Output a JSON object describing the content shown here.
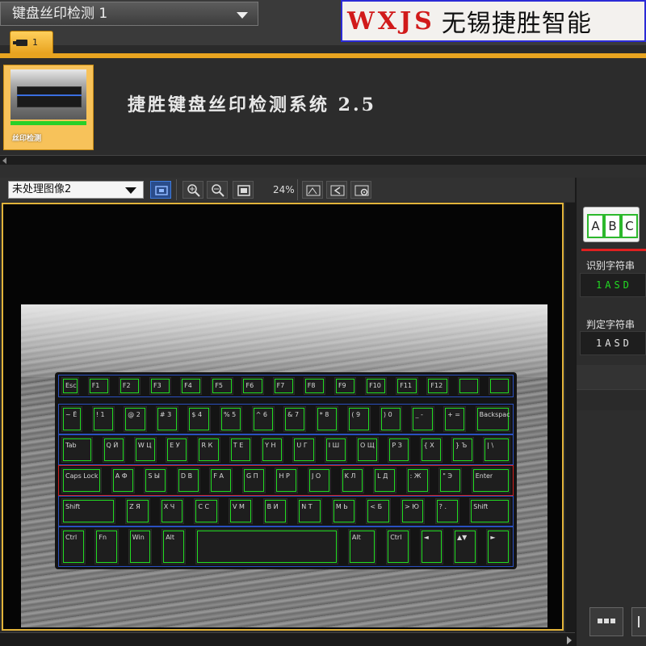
{
  "scene_selector": {
    "value": "键盘丝印检测 1"
  },
  "brand": {
    "code": "WXJS",
    "name": "无锡捷胜智能"
  },
  "tab": {
    "label": "1"
  },
  "thumbnail": {
    "label": "丝印检测"
  },
  "app_title": "捷胜键盘丝印检测系统 2.5",
  "image_toolbar": {
    "image_source": "未处理图像2",
    "zoom": "24%"
  },
  "right_panel": {
    "abc_letters": [
      "A",
      "B",
      "C"
    ],
    "recognized_label": "识别字符串",
    "recognized_value": "1ASD",
    "judge_label": "判定字符串",
    "judge_value": "1ASD"
  },
  "keyboard": {
    "rows": [
      {
        "name": "function-row",
        "keys": [
          {
            "t": "Esc",
            "w": 24
          },
          {
            "t": "F1",
            "w": 30
          },
          {
            "t": "F2",
            "w": 30
          },
          {
            "t": "F3",
            "w": 30
          },
          {
            "t": "F4",
            "w": 30
          },
          {
            "t": "F5",
            "w": 30
          },
          {
            "t": "F6",
            "w": 30
          },
          {
            "t": "F7",
            "w": 30
          },
          {
            "t": "F8",
            "w": 30
          },
          {
            "t": "F9",
            "w": 30
          },
          {
            "t": "F10",
            "w": 30
          },
          {
            "t": "F11",
            "w": 30
          },
          {
            "t": "F12",
            "w": 30
          },
          {
            "t": "",
            "w": 30
          },
          {
            "t": "",
            "w": 30
          }
        ]
      },
      {
        "name": "number-row",
        "keys": [
          {
            "t": "~ Ё",
            "w": 28
          },
          {
            "t": "! 1",
            "w": 30
          },
          {
            "t": "@ 2",
            "w": 30
          },
          {
            "t": "# 3",
            "w": 30
          },
          {
            "t": "$ 4",
            "w": 30
          },
          {
            "t": "% 5",
            "w": 30
          },
          {
            "t": "^ 6",
            "w": 30
          },
          {
            "t": "& 7",
            "w": 30
          },
          {
            "t": "* 8",
            "w": 30
          },
          {
            "t": "( 9",
            "w": 30
          },
          {
            "t": ") 0",
            "w": 30
          },
          {
            "t": "_ -",
            "w": 30
          },
          {
            "t": "+ =",
            "w": 30
          },
          {
            "t": "Backspace",
            "w": 46
          }
        ]
      },
      {
        "name": "qwerty-row",
        "keys": [
          {
            "t": "Tab",
            "w": 42
          },
          {
            "t": "Q Й",
            "w": 30
          },
          {
            "t": "W Ц",
            "w": 30
          },
          {
            "t": "E У",
            "w": 30
          },
          {
            "t": "R К",
            "w": 30
          },
          {
            "t": "T Е",
            "w": 30
          },
          {
            "t": "Y Н",
            "w": 30
          },
          {
            "t": "U Г",
            "w": 30
          },
          {
            "t": "I Ш",
            "w": 30
          },
          {
            "t": "O Щ",
            "w": 30
          },
          {
            "t": "P З",
            "w": 30
          },
          {
            "t": "{ Х",
            "w": 30
          },
          {
            "t": "} Ъ",
            "w": 30
          },
          {
            "t": "| \\",
            "w": 36
          }
        ]
      },
      {
        "name": "asdf-row",
        "keys": [
          {
            "t": "Caps Lock",
            "w": 52
          },
          {
            "t": "A Ф",
            "w": 30
          },
          {
            "t": "S Ы",
            "w": 30
          },
          {
            "t": "D В",
            "w": 30
          },
          {
            "t": "F А",
            "w": 30
          },
          {
            "t": "G П",
            "w": 30
          },
          {
            "t": "H Р",
            "w": 30
          },
          {
            "t": "J О",
            "w": 30
          },
          {
            "t": "K Л",
            "w": 30
          },
          {
            "t": "L Д",
            "w": 30
          },
          {
            "t": ": Ж",
            "w": 30
          },
          {
            "t": "\" Э",
            "w": 30
          },
          {
            "t": "Enter",
            "w": 50
          }
        ]
      },
      {
        "name": "zxcv-row",
        "keys": [
          {
            "t": "Shift",
            "w": 66
          },
          {
            "t": "Z Я",
            "w": 30
          },
          {
            "t": "X Ч",
            "w": 30
          },
          {
            "t": "C С",
            "w": 30
          },
          {
            "t": "V М",
            "w": 30
          },
          {
            "t": "B И",
            "w": 30
          },
          {
            "t": "N Т",
            "w": 30
          },
          {
            "t": "M Ь",
            "w": 30
          },
          {
            "t": "< Б",
            "w": 30
          },
          {
            "t": "> Ю",
            "w": 30
          },
          {
            "t": "? .",
            "w": 30
          },
          {
            "t": "Shift",
            "w": 50
          }
        ]
      },
      {
        "name": "space-row",
        "keys": [
          {
            "t": "Ctrl",
            "w": 30
          },
          {
            "t": "Fn",
            "w": 30
          },
          {
            "t": "Win",
            "w": 30
          },
          {
            "t": "Alt",
            "w": 30
          },
          {
            "t": "",
            "w": 180
          },
          {
            "t": "Alt",
            "w": 36
          },
          {
            "t": "Ctrl",
            "w": 30
          },
          {
            "t": "◄",
            "w": 30
          },
          {
            "t": "▲▼",
            "w": 30
          },
          {
            "t": "►",
            "w": 30
          }
        ]
      }
    ]
  }
}
